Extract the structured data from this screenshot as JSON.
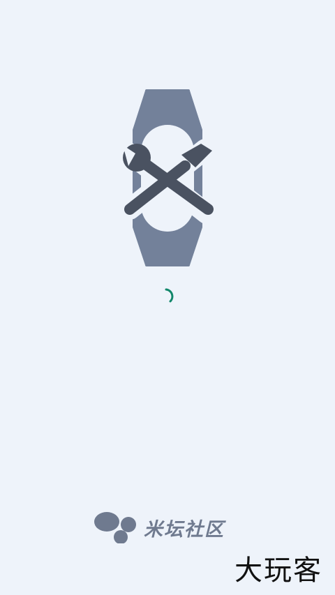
{
  "splash": {
    "illustration_icon": "band-with-wrench-and-screwdriver-icon",
    "spinner_icon": "loading-spinner-icon"
  },
  "footer": {
    "brand_name": "米坛社区",
    "brand_logo_icon": "three-dots-logo-icon"
  },
  "watermark": {
    "text": "大玩客"
  },
  "colors": {
    "background": "#eef3fa",
    "band": "#73819a",
    "tools": "#4a5261",
    "spinner": "#12876a",
    "brand_text": "#6f7a8f",
    "watermark": "#111111"
  }
}
